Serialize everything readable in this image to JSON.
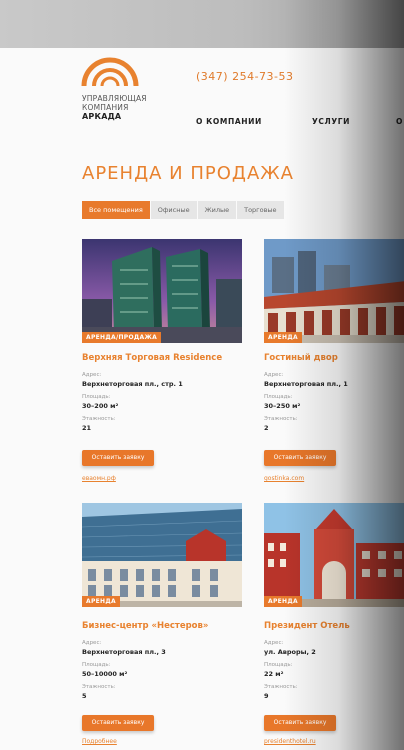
{
  "header": {
    "brand_lines": [
      "УПРАВЛЯЮЩАЯ",
      "КОМПАНИЯ",
      "АРКАДА"
    ],
    "phone": "(347) 254-73-53",
    "nav": [
      "О КОМПАНИИ",
      "УСЛУГИ",
      "О"
    ]
  },
  "page": {
    "title": "АРЕНДА И ПРОДАЖА",
    "filters": [
      "Все помещения",
      "Офисные",
      "Жилые",
      "Торговые"
    ]
  },
  "labels": {
    "address": "Адрес:",
    "area": "Площадь:",
    "floors": "Этажность:",
    "request": "Оставить заявку"
  },
  "cards": [
    {
      "tag": "АРЕНДА/ПРОДАЖА",
      "title": "Верхняя Торговая Residence",
      "address": "Верхнеторговая пл., стр. 1",
      "area": "30–200 м²",
      "floors": "21",
      "link": "еваомн.рф"
    },
    {
      "tag": "АРЕНДА",
      "title": "Гостиный двор",
      "address": "Верхнеторговая пл., 1",
      "area": "30–250 м²",
      "floors": "2",
      "link": "gostinka.com"
    },
    {
      "tag": "АРЕНДА",
      "title": "Бизнес-центр «Нестеров»",
      "address": "Верхнеторговая пл., 3",
      "area": "50–10000 м²",
      "floors": "5",
      "link": "Подробнее"
    },
    {
      "tag": "АРЕНДА",
      "title": "Президент Отель",
      "address": "ул. Авроры, 2",
      "area": "22 м²",
      "floors": "9",
      "link": "presidenthotel.ru"
    }
  ],
  "colors": {
    "accent": "#e8822f",
    "button": "#e8772a",
    "tab_bg": "#e6e6e6"
  }
}
